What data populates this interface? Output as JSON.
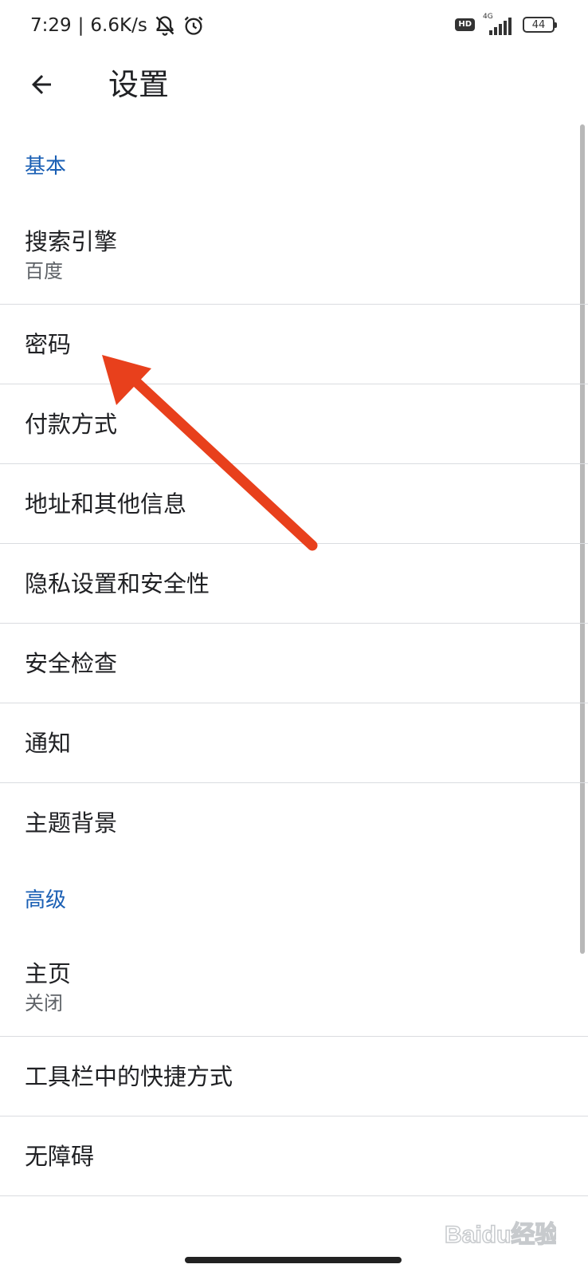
{
  "status_bar": {
    "time": "7:29",
    "separator": "|",
    "net_speed": "6.6K/s",
    "hd_label": "HD",
    "network_type": "4G",
    "battery": "44",
    "icons": [
      "mute-notification-icon",
      "alarm-icon",
      "signal-icon",
      "battery-icon"
    ]
  },
  "app_bar": {
    "title": "设置",
    "back_icon": "back-arrow-icon"
  },
  "sections": {
    "basic": {
      "header": "基本",
      "items": [
        {
          "title": "搜索引擎",
          "subtitle": "百度"
        },
        {
          "title": "密码"
        },
        {
          "title": "付款方式"
        },
        {
          "title": "地址和其他信息"
        },
        {
          "title": "隐私设置和安全性"
        },
        {
          "title": "安全检查"
        },
        {
          "title": "通知"
        },
        {
          "title": "主题背景"
        }
      ]
    },
    "advanced": {
      "header": "高级",
      "items": [
        {
          "title": "主页",
          "subtitle": "关闭"
        },
        {
          "title": "工具栏中的快捷方式"
        },
        {
          "title": "无障碍"
        }
      ]
    }
  },
  "annotation": {
    "color": "#e8401c",
    "target": "密码"
  },
  "colors": {
    "section_header": "#1a5fb4",
    "text_primary": "#202124",
    "text_secondary": "#5f6368",
    "divider": "#dadce0"
  },
  "watermark": {
    "text": "Baidu经验"
  }
}
